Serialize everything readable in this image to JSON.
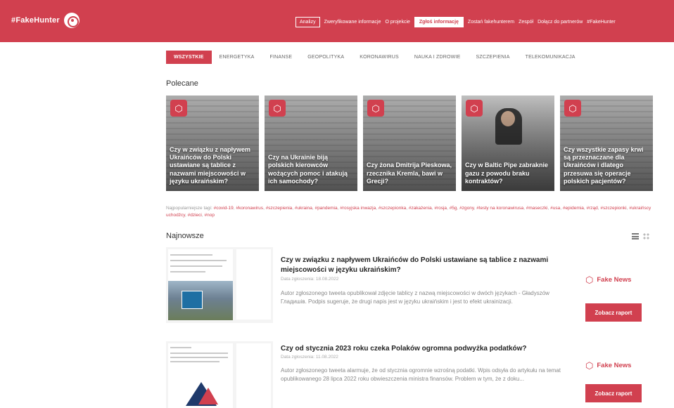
{
  "header": {
    "brand": "#FakeHunter",
    "nav": [
      {
        "label": "Analizy",
        "style": "outline"
      },
      {
        "label": "Zweryfikowane informacje",
        "style": "link"
      },
      {
        "label": "O projekcie",
        "style": "link"
      },
      {
        "label": "Zgłoś informację",
        "style": "cta"
      },
      {
        "label": "Zostań fakehunterem",
        "style": "link"
      },
      {
        "label": "Zespół",
        "style": "link"
      },
      {
        "label": "Dołącz do partnerów",
        "style": "link"
      },
      {
        "label": "#FakeHunter",
        "style": "link"
      }
    ]
  },
  "categories": [
    {
      "label": "WSZYSTKIE",
      "active": true
    },
    {
      "label": "ENERGETYKA",
      "active": false
    },
    {
      "label": "FINANSE",
      "active": false
    },
    {
      "label": "GEOPOLITYKA",
      "active": false
    },
    {
      "label": "KORONAWIRUS",
      "active": false
    },
    {
      "label": "NAUKA I ZDROWIE",
      "active": false
    },
    {
      "label": "SZCZEPIENIA",
      "active": false
    },
    {
      "label": "TELEKOMUNIKACJA",
      "active": false
    }
  ],
  "featured": {
    "title": "Polecane",
    "cards": [
      {
        "title": "Czy w związku z napływem Ukraińców do Polski ustawiane są tablice z nazwami miejscowości w języku ukraińskim?"
      },
      {
        "title": "Czy na Ukrainie biją polskich kierowców wożących pomoc i atakują ich samochody?"
      },
      {
        "title": "Czy żona Dmitrija Pieskowa, rzecznika Kremla, bawi w Grecji?"
      },
      {
        "title": "Czy w Baltic Pipe zabraknie gazu z powodu braku kontraktów?"
      },
      {
        "title": "Czy wszystkie zapasy krwi są przeznaczane dla Ukraińców i dlatego przesuwa się operacje polskich pacjentów?"
      }
    ]
  },
  "tags": {
    "label": "Najpopularniejsze tagi:",
    "items": [
      "#covid-19",
      "#koronawirus",
      "#szczepienia",
      "#ukraina",
      "#pandemia",
      "#rosyjska inwazja",
      "#szczepionka",
      "#zakażenia",
      "#rosja",
      "#5g",
      "#zgony",
      "#testy na koronawirusa",
      "#maseczki",
      "#usa",
      "#epidemia",
      "#rząd",
      "#szczepionki",
      "#ukraińscy uchodźcy",
      "#dzieci",
      "#nop"
    ]
  },
  "latest": {
    "title": "Najnowsze",
    "articles": [
      {
        "title": "Czy w związku z napływem Ukraińców do Polski ustawiane są tablice z nazwami miejscowości w języku ukraińskim?",
        "meta": "Data zgłoszenia: 18.08.2022",
        "excerpt": "Autor zgłoszonego tweeta opublikował zdjęcie tablicy z nazwą miejscowości w dwóch językach - Gładyszów Гладишів. Podpis sugeruje, że drugi napis jest w języku ukraińskim i jest to efekt ukrainizacji.",
        "verdict": "Fake News",
        "button": "Zobacz raport"
      },
      {
        "title": "Czy od stycznia 2023 roku czeka Polaków ogromna podwyżka podatków?",
        "meta": "Data zgłoszenia: 11.08.2022",
        "excerpt": "Autor zgłoszonego tweeta alarmuje, że od stycznia ogromnie wzrośną podatki. Wpis odsyła do artykułu na temat opublikowanego 28 lipca 2022 roku obwieszczenia ministra finansów. Problem w tym, że z doku...",
        "verdict": "Fake News",
        "button": "Zobacz raport"
      }
    ]
  },
  "colors": {
    "brand": "#d1404f",
    "text": "#333333",
    "muted": "#888888"
  },
  "icons": {
    "brand": "target-logo-icon",
    "card_badge": "fakehunter-badge-icon",
    "verdict": "fakehunter-verdict-icon",
    "view_list": "list-view-icon",
    "view_grid": "grid-view-icon"
  }
}
